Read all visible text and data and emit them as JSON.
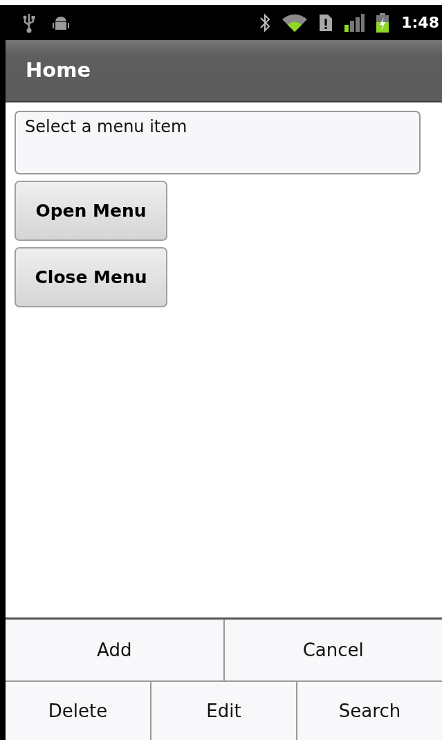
{
  "status_bar": {
    "time": "1:48"
  },
  "action_bar": {
    "title": "Home"
  },
  "text_field": {
    "value": "Select a menu item"
  },
  "buttons": [
    {
      "label": "Open Menu"
    },
    {
      "label": "Close Menu"
    }
  ],
  "options_menu": {
    "rows": [
      [
        {
          "label": "Add"
        },
        {
          "label": "Cancel"
        }
      ],
      [
        {
          "label": "Delete"
        },
        {
          "label": "Edit"
        },
        {
          "label": "Search"
        }
      ]
    ]
  }
}
